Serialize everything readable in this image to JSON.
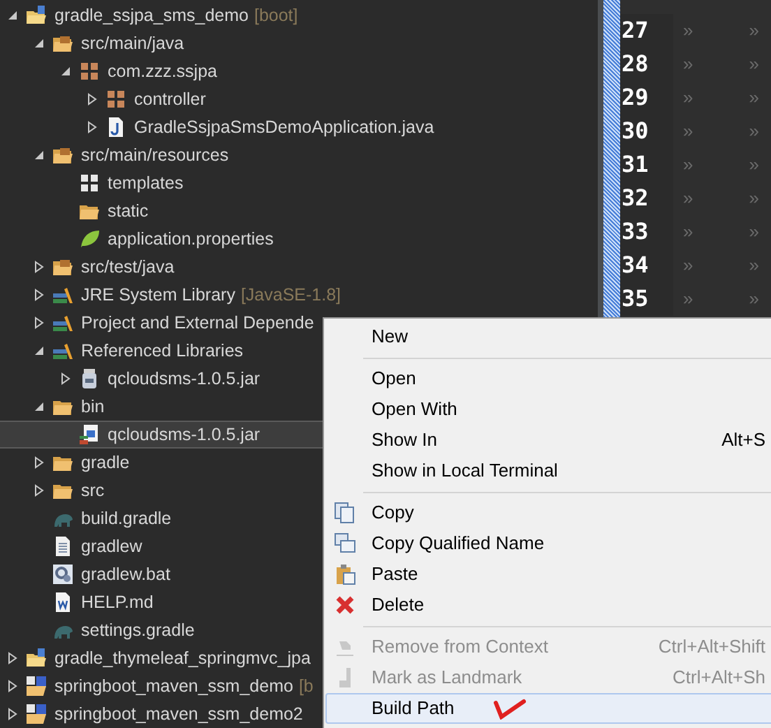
{
  "tree": [
    {
      "label": "gradle_ssjpa_sms_demo",
      "decoration": "[boot]",
      "kind": "project",
      "expanded": true,
      "selected": false,
      "children": [
        {
          "label": "src/main/java",
          "kind": "source-folder",
          "expanded": true,
          "selected": false,
          "children": [
            {
              "label": "com.zzz.ssjpa",
              "kind": "package",
              "expanded": true,
              "selected": false,
              "children": [
                {
                  "label": "controller",
                  "kind": "package",
                  "expanded": false,
                  "selected": false
                },
                {
                  "label": "GradleSsjpaSmsDemoApplication.java",
                  "kind": "java",
                  "expanded": false,
                  "selected": false
                }
              ]
            }
          ]
        },
        {
          "label": "src/main/resources",
          "kind": "source-folder",
          "expanded": true,
          "selected": false,
          "children": [
            {
              "label": "templates",
              "kind": "empty-package",
              "selected": false
            },
            {
              "label": "static",
              "kind": "folder",
              "selected": false
            },
            {
              "label": "application.properties",
              "kind": "properties",
              "selected": false
            }
          ]
        },
        {
          "label": "src/test/java",
          "kind": "source-folder",
          "expanded": false,
          "selected": false
        },
        {
          "label": "JRE System Library",
          "decoration": "[JavaSE-1.8]",
          "kind": "library",
          "expanded": false,
          "selected": false
        },
        {
          "label": "Project and External Depende",
          "kind": "library",
          "expanded": false,
          "selected": false
        },
        {
          "label": "Referenced Libraries",
          "kind": "library",
          "expanded": true,
          "selected": false,
          "children": [
            {
              "label": "qcloudsms-1.0.5.jar",
              "kind": "jar",
              "expanded": false,
              "selected": false
            }
          ]
        },
        {
          "label": "bin",
          "kind": "folder",
          "expanded": true,
          "selected": false,
          "children": [
            {
              "label": "qcloudsms-1.0.5.jar",
              "kind": "jar-file",
              "selected": true
            }
          ]
        },
        {
          "label": "gradle",
          "kind": "folder",
          "expanded": false,
          "selected": false
        },
        {
          "label": "src",
          "kind": "folder",
          "expanded": false,
          "selected": false
        },
        {
          "label": "build.gradle",
          "kind": "gradle",
          "selected": false
        },
        {
          "label": "gradlew",
          "kind": "file",
          "selected": false
        },
        {
          "label": "gradlew.bat",
          "kind": "bat",
          "selected": false
        },
        {
          "label": "HELP.md",
          "kind": "doc",
          "selected": false
        },
        {
          "label": "settings.gradle",
          "kind": "gradle",
          "selected": false
        }
      ]
    },
    {
      "label": "gradle_thymeleaf_springmvc_jpa",
      "kind": "project",
      "expanded": false,
      "selected": false
    },
    {
      "label": "springboot_maven_ssm_demo",
      "decoration": "[b",
      "kind": "maven",
      "expanded": false,
      "selected": false
    },
    {
      "label": "springboot_maven_ssm_demo2",
      "kind": "maven",
      "expanded": false,
      "selected": false
    }
  ],
  "editor": {
    "lines": [
      {
        "number": "27",
        "marks": [
          "»",
          "»"
        ]
      },
      {
        "number": "28",
        "marks": [
          "»",
          "»"
        ]
      },
      {
        "number": "29",
        "marks": [
          "»",
          "»"
        ]
      },
      {
        "number": "30",
        "marks": [
          "»",
          "»"
        ]
      },
      {
        "number": "31",
        "marks": [
          "»",
          "»"
        ]
      },
      {
        "number": "32",
        "marks": [
          "»",
          "»"
        ]
      },
      {
        "number": "33",
        "marks": [
          "»",
          "»"
        ]
      },
      {
        "number": "34",
        "marks": [
          "»",
          "»"
        ]
      },
      {
        "number": "35",
        "marks": [
          "»",
          "»"
        ]
      }
    ]
  },
  "context_menu": {
    "items": [
      {
        "kind": "plain",
        "label": "New",
        "disabled": false,
        "selected": false
      },
      {
        "kind": "separator"
      },
      {
        "kind": "plain",
        "label": "Open",
        "disabled": false,
        "selected": false
      },
      {
        "kind": "plain",
        "label": "Open With",
        "disabled": false,
        "selected": false
      },
      {
        "kind": "plain",
        "label": "Show In",
        "shortcut": "Alt+S",
        "disabled": false,
        "selected": false
      },
      {
        "kind": "plain",
        "label": "Show in Local Terminal",
        "disabled": false,
        "selected": false
      },
      {
        "kind": "separator"
      },
      {
        "kind": "copy",
        "label": "Copy",
        "disabled": false,
        "selected": false
      },
      {
        "kind": "copy-name",
        "label": "Copy Qualified Name",
        "disabled": false,
        "selected": false
      },
      {
        "kind": "paste",
        "label": "Paste",
        "disabled": false,
        "selected": false
      },
      {
        "kind": "delete",
        "label": "Delete",
        "disabled": false,
        "selected": false
      },
      {
        "kind": "separator"
      },
      {
        "kind": "remove",
        "label": "Remove from Context",
        "shortcut": "Ctrl+Alt+Shift",
        "disabled": true,
        "selected": false
      },
      {
        "kind": "landmark",
        "label": "Mark as Landmark",
        "shortcut": "Ctrl+Alt+Sh",
        "disabled": true,
        "selected": false
      },
      {
        "kind": "plain",
        "label": "Build Path",
        "disabled": false,
        "selected": true
      }
    ]
  }
}
